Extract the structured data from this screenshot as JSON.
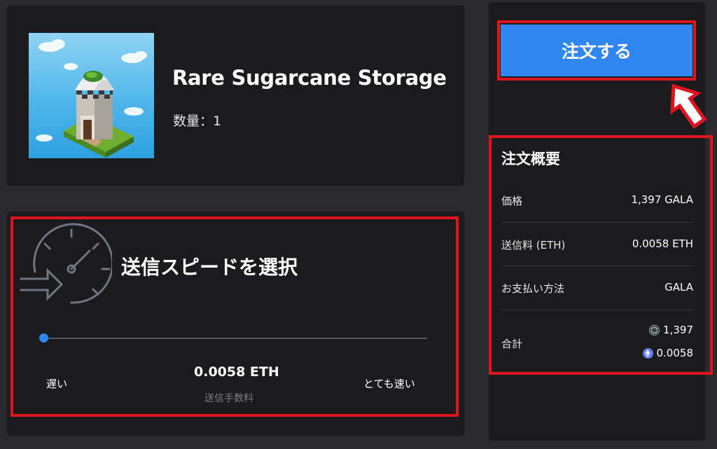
{
  "item": {
    "title": "Rare Sugarcane Storage",
    "quantity_label": "数量：1"
  },
  "speed": {
    "title": "送信スピードを選択",
    "slow_label": "遅い",
    "fast_label": "とても速い",
    "fee_value": "0.0058 ETH",
    "fee_caption": "送信手数料",
    "slider_level": 0
  },
  "order": {
    "button_label": "注文する"
  },
  "summary": {
    "title": "注文概要",
    "rows": [
      {
        "label": "価格",
        "value": "1,397 GALA"
      },
      {
        "label": "送信料 (ETH)",
        "value": "0.0058 ETH"
      },
      {
        "label": "お支払い方法",
        "value": "GALA"
      }
    ],
    "total_label": "合計",
    "total_gala": "1,397",
    "total_eth": "0.0058"
  },
  "colors": {
    "accent": "#2f86f0",
    "highlight": "#e0141e",
    "panel": "#1b1b1e",
    "background": "#2a2a2e"
  }
}
